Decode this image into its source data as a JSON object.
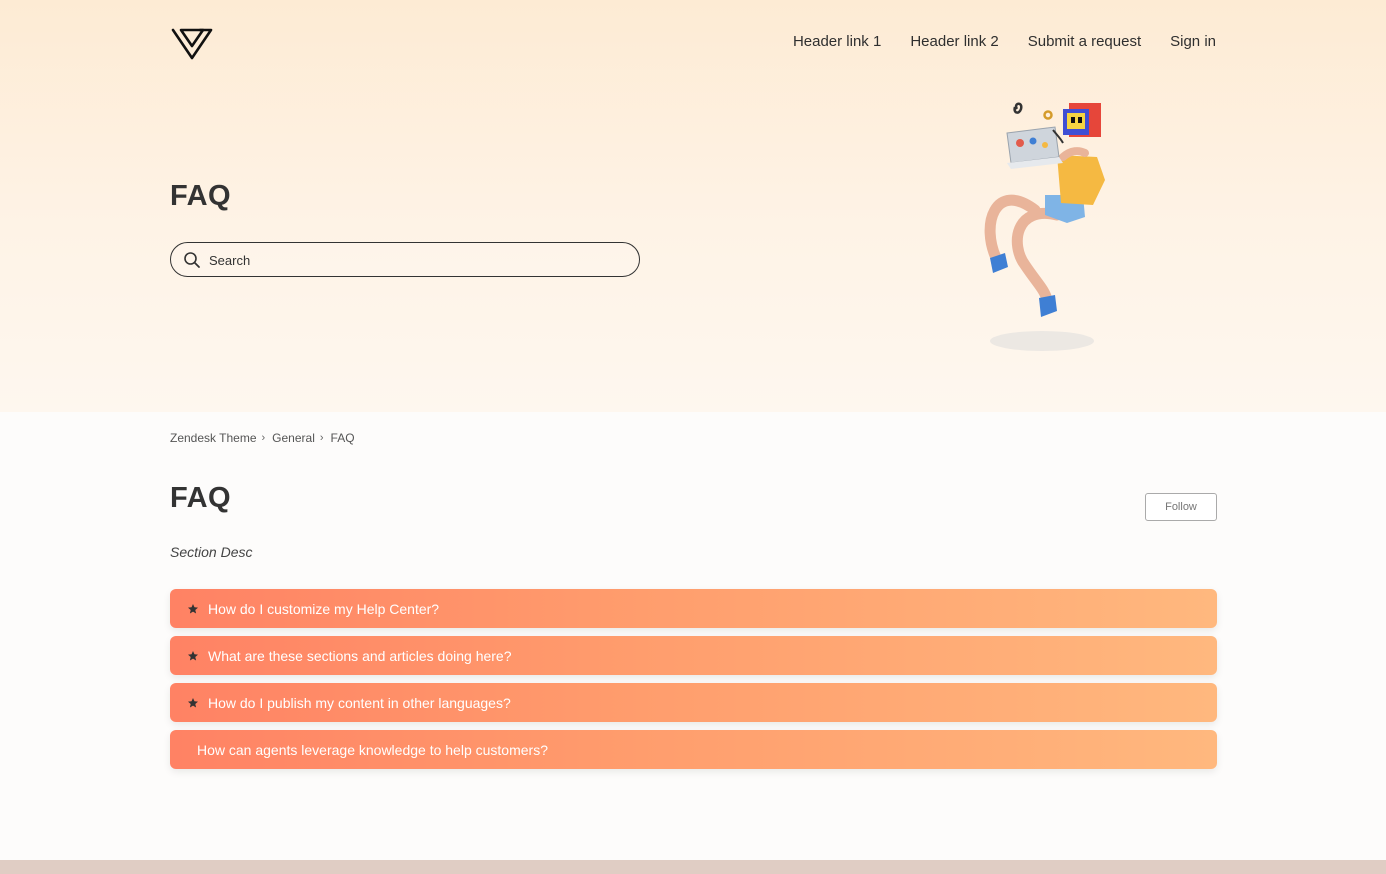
{
  "header": {
    "logo_icon": "v-logo-icon",
    "nav": [
      "Header link 1",
      "Header link 2",
      "Submit a request",
      "Sign in"
    ]
  },
  "hero": {
    "title": "FAQ",
    "search_placeholder": "Search",
    "illustration": "person-with-laptop-illustration"
  },
  "breadcrumb": [
    "Zendesk Theme",
    "General",
    "FAQ"
  ],
  "section": {
    "title": "FAQ",
    "follow_label": "Follow",
    "description": "Section Desc"
  },
  "articles": [
    {
      "title": "How do I customize my Help Center?",
      "promoted": true
    },
    {
      "title": "What are these sections and articles doing here?",
      "promoted": true
    },
    {
      "title": "How do I publish my content in other languages?",
      "promoted": true
    },
    {
      "title": "How can agents leverage knowledge to help customers?",
      "promoted": false
    }
  ],
  "colors": {
    "accent_start": "#ff8264",
    "accent_end": "#ffb87e",
    "hero_bg": "#fdebd4",
    "footer_bar": "#e0cdc4"
  }
}
